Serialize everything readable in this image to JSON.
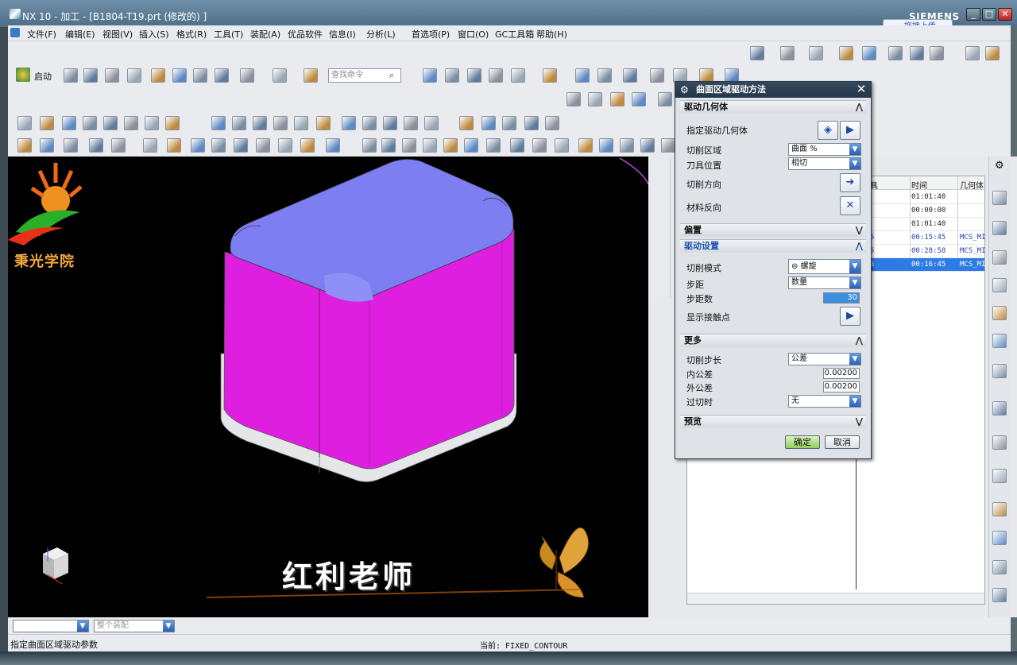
{
  "window": {
    "title": "NX 10 - 加工 - [B1804-T19.prt (修改的) ]",
    "brand": "SIEMENS",
    "upload_label": "拖拽上传"
  },
  "menu": [
    "文件(F)",
    "编辑(E)",
    "视图(V)",
    "插入(S)",
    "格式(R)",
    "工具(T)",
    "装配(A)",
    "优品软件",
    "信息(I)",
    "分析(L)",
    "首选项(P)",
    "窗口(O)",
    "GC工具箱",
    "帮助(H)"
  ],
  "toolbar": {
    "start_label": "启动",
    "search_placeholder": "查找命令"
  },
  "dialog": {
    "title": "曲面区域驱动方法",
    "sections": {
      "drive_geometry": "驱动几何体",
      "offset": "偏置",
      "drive_settings": "驱动设置",
      "more": "更多",
      "preview": "预览"
    },
    "fields": {
      "specify_drive_geometry": "指定驱动几何体",
      "cut_region_label": "切削区域",
      "cut_region_value": "曲面 %",
      "tool_position_label": "刀具位置",
      "tool_position_value": "相切",
      "cut_direction_label": "切削方向",
      "material_reverse_label": "材料反向",
      "cut_mode_label": "切削模式",
      "cut_mode_value": "螺旋",
      "stepover_label": "步距",
      "stepover_value": "数量",
      "step_count_label": "步距数",
      "step_count_value": "30",
      "show_contact_label": "显示接触点",
      "cut_step_label": "切削步长",
      "cut_step_value": "公差",
      "intol_label": "内公差",
      "intol_value": "0.00200",
      "outtol_label": "外公差",
      "outtol_value": "0.00200",
      "overcut_label": "过切时",
      "overcut_value": "无"
    },
    "ok": "确定",
    "cancel": "取消"
  },
  "navigator": {
    "headers": [
      "具",
      "时间",
      "几何体"
    ],
    "rows": [
      {
        "c1": "",
        "time": "01:01:40",
        "geo": ""
      },
      {
        "c1": "",
        "time": "00:00:00",
        "geo": ""
      },
      {
        "c1": "",
        "time": "01:01:40",
        "geo": ""
      },
      {
        "c1": "5",
        "time": "00:15:45",
        "geo": "MCS_MI"
      },
      {
        "c1": "5",
        "time": "00:28:58",
        "geo": "MCS_MI"
      },
      {
        "c1": "5",
        "time": "00:16:45",
        "geo": "MCS_MI"
      }
    ]
  },
  "overlay": {
    "school": "秉光学院",
    "teacher": "红利老师"
  },
  "bottombar": {
    "filter_placeholder": "整个装配"
  },
  "status": {
    "prompt": "指定曲面区域驱动参数",
    "current": "当前: FIXED_CONTOUR"
  },
  "colors": {
    "top_face": "#7b7cf0",
    "side_face": "#e01ee0",
    "base_face": "#e8e8ea",
    "dialog_title": "#23364a",
    "accent_blue": "#1f55b5"
  }
}
